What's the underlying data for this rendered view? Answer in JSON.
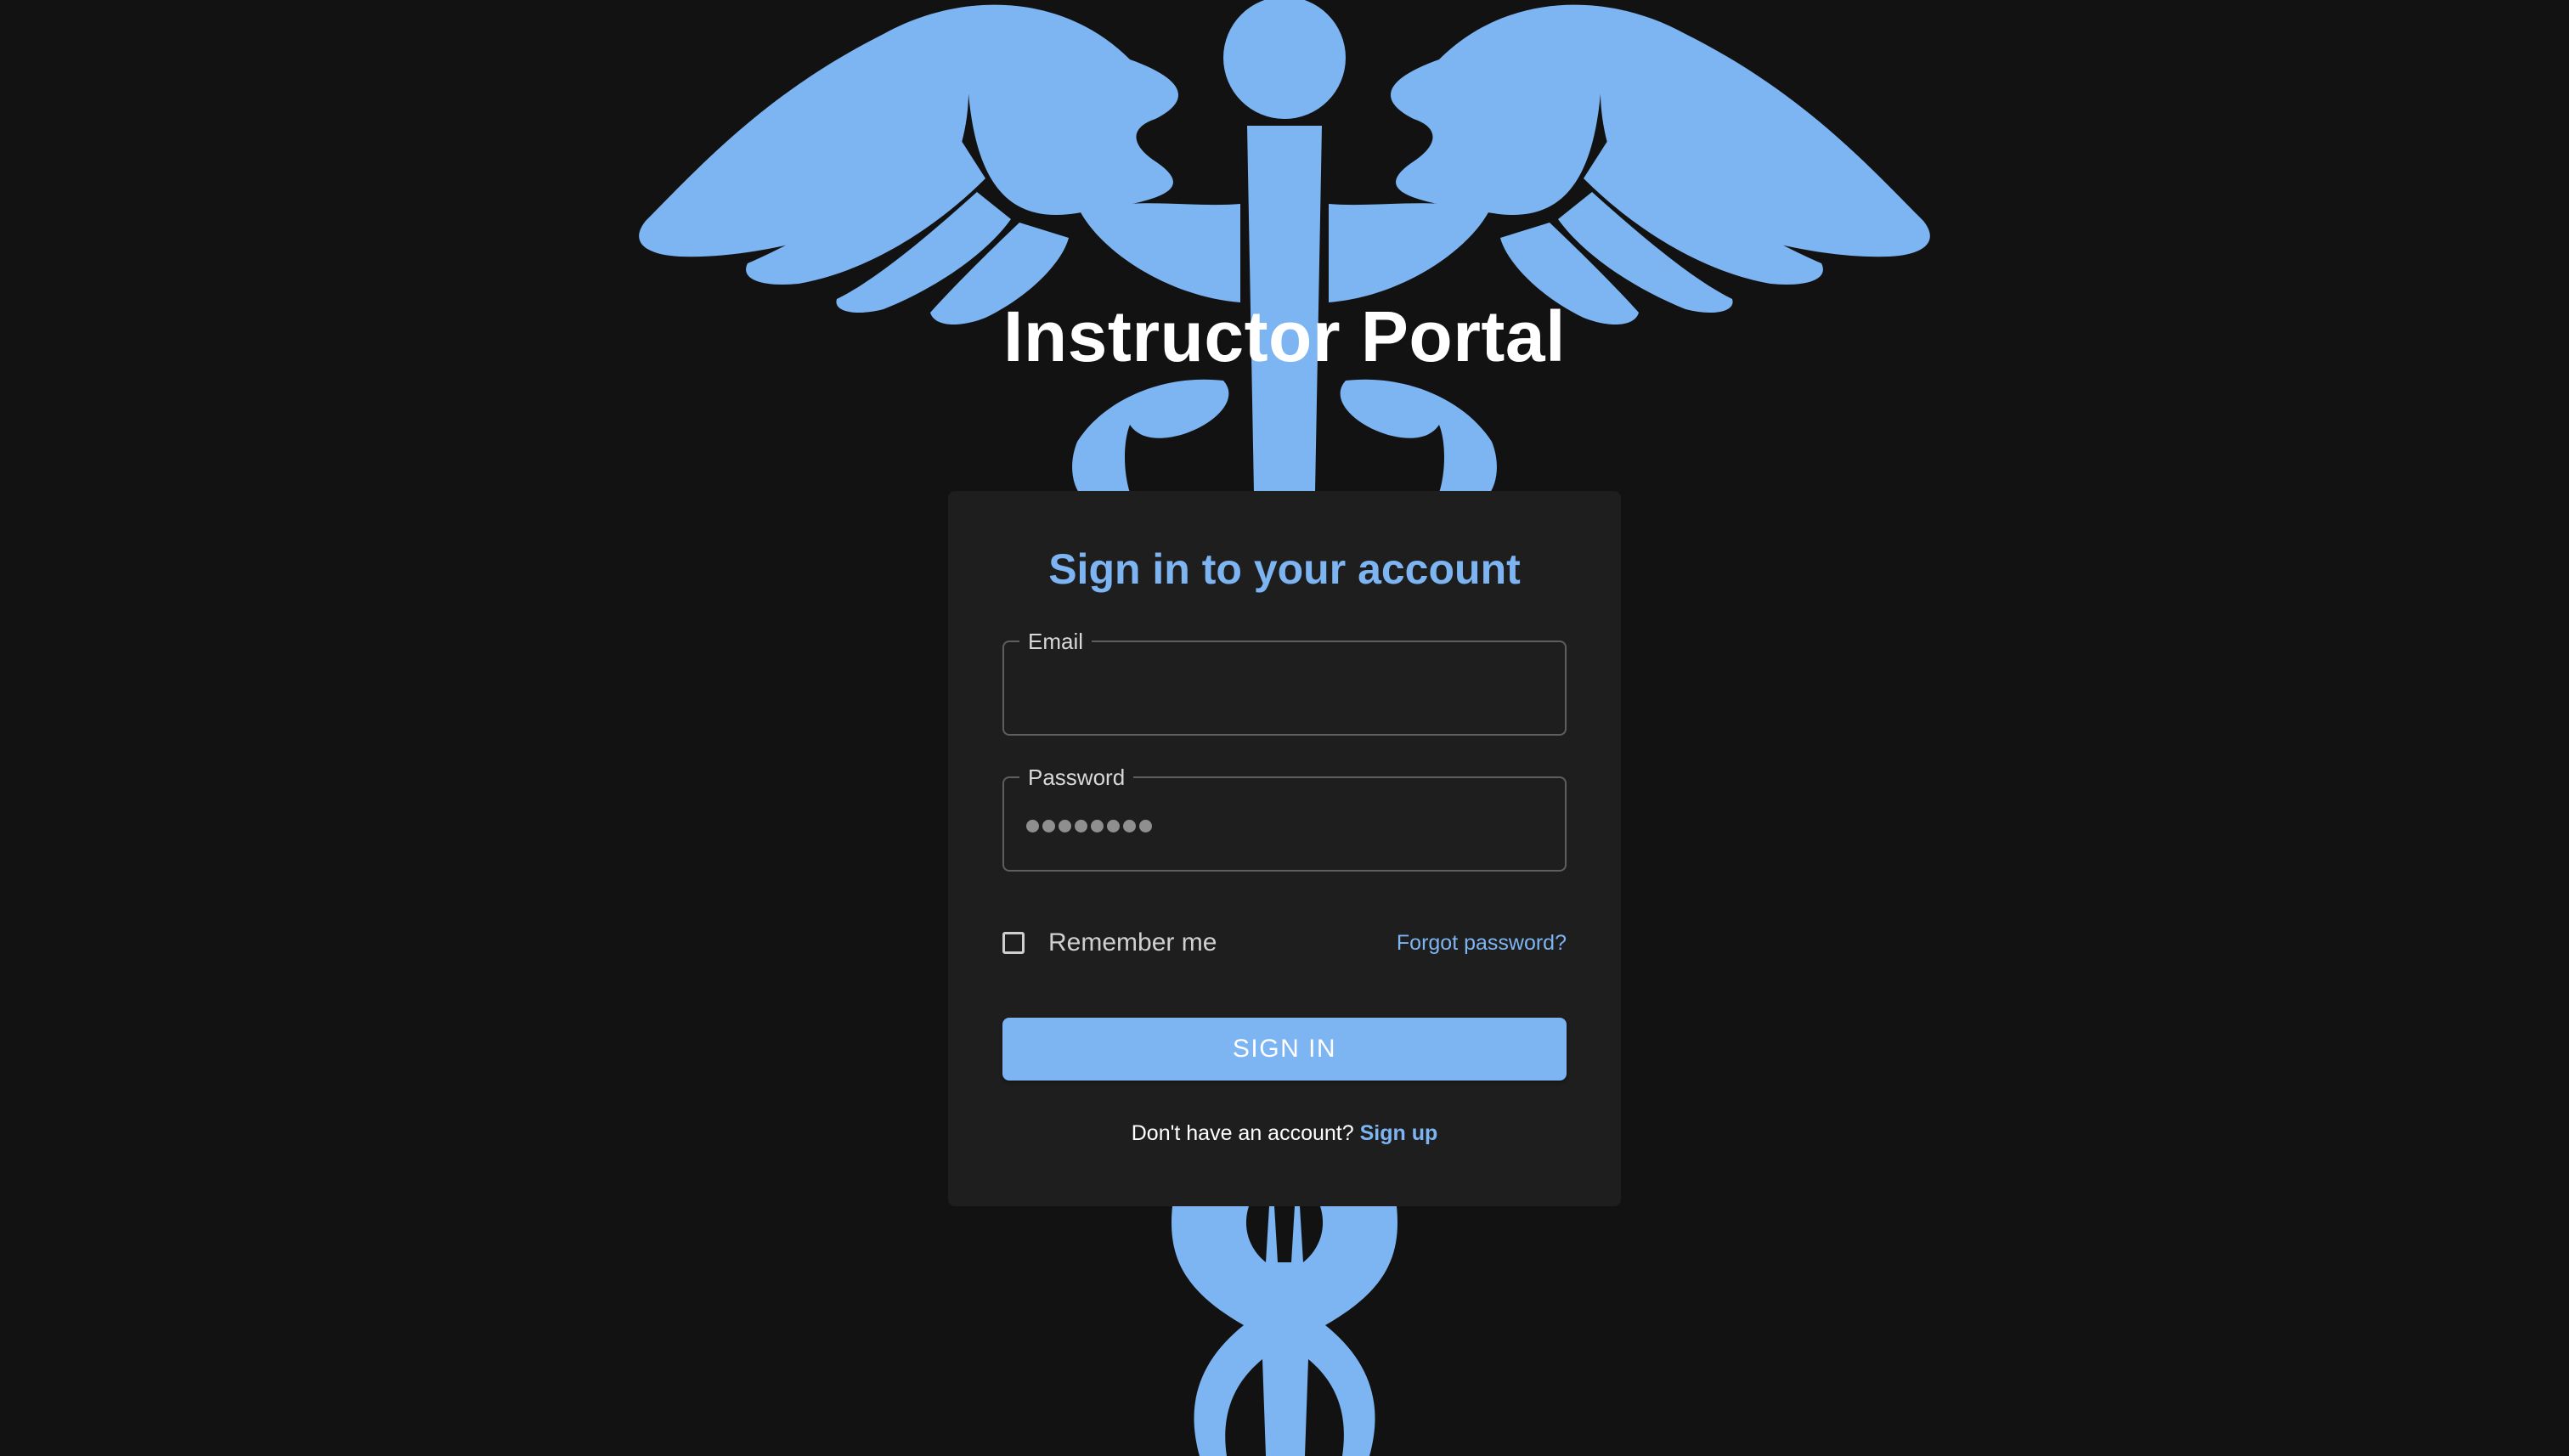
{
  "page": {
    "title": "Instructor Portal"
  },
  "emblem": {
    "icon": "caduceus-icon",
    "color": "#7db4f2"
  },
  "login_card": {
    "heading": "Sign in to your account",
    "email": {
      "label": "Email",
      "value": ""
    },
    "password": {
      "label": "Password",
      "masked_length": 8
    },
    "remember_me": {
      "label": "Remember me",
      "checked": false
    },
    "forgot_password": "Forgot password?",
    "submit_label": "SIGN IN",
    "signup_prompt": "Don't have an account?",
    "signup_link": "Sign up"
  },
  "colors": {
    "background": "#121212",
    "card": "#1e1e1e",
    "accent": "#7db4f2",
    "text": "#ffffff"
  }
}
